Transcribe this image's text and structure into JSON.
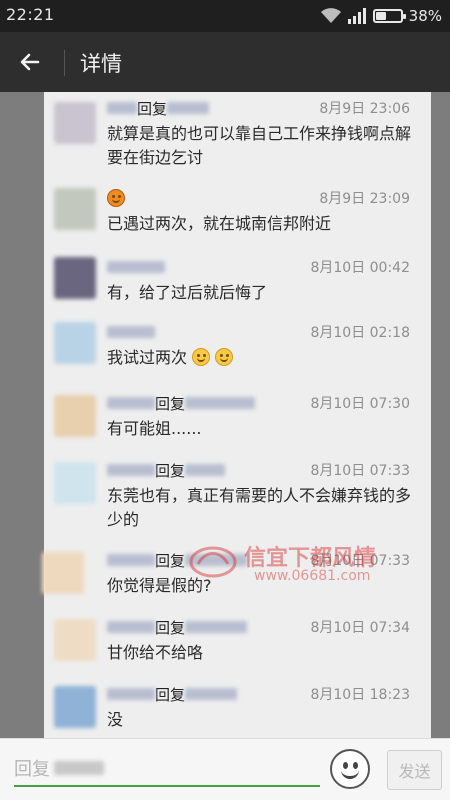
{
  "status_bar": {
    "time": "22:21",
    "battery_percent": "38%",
    "battery_level": 0.38,
    "wifi_icon": "wifi-icon",
    "signal_icon": "signal-icon"
  },
  "header": {
    "back_icon": "back-arrow-icon",
    "title": "详情"
  },
  "comments": [
    {
      "name_suffix": "回复",
      "time": "8月9日 23:06",
      "text": "就算是真的也可以靠自己工作来挣钱啊点解要在街边乞讨",
      "avatar_color": "#c9c4cf"
    },
    {
      "name_suffix": "",
      "time": "8月9日 23:09",
      "text": "已遇过两次，就在城南信邦附近",
      "name_icon": "pumpkin-emoji-icon",
      "avatar_color": "#c2c8bd"
    },
    {
      "name_suffix": "",
      "time": "8月10日 00:42",
      "text": "有，给了过后就后悔了",
      "avatar_color": "#6b6680"
    },
    {
      "name_suffix": "",
      "time": "8月10日 02:18",
      "text": "我试过两次",
      "trailing_icon": "smile-emoji-icon",
      "avatar_color": "#b9d3e6"
    },
    {
      "name_suffix": "回复",
      "time": "8月10日 07:30",
      "text": "有可能姐......",
      "avatar_color": "#e8cfae"
    },
    {
      "name_suffix": "回复",
      "time": "8月10日 07:33",
      "text": "东莞也有，真正有需要的人不会嫌弃钱的多少的",
      "avatar_color": "#cfe4ec"
    },
    {
      "name_suffix": "回复",
      "time": "8月10日 07:33",
      "text": "你觉得是假的?",
      "avatar_color": "#eed9bf"
    },
    {
      "name_suffix": "回复",
      "time": "8月10日 07:34",
      "text": "甘你给不给咯",
      "avatar_color": "#eedcc4"
    },
    {
      "name_suffix": "回复",
      "time": "8月10日 18:23",
      "text": "没",
      "avatar_color": "#8fb2d6"
    }
  ],
  "watermark": {
    "text": "信宜下都风情",
    "url": "www.06681.com"
  },
  "input_bar": {
    "placeholder": "回复",
    "emoji_icon": "emoji-face-icon",
    "send_label": "发送"
  }
}
